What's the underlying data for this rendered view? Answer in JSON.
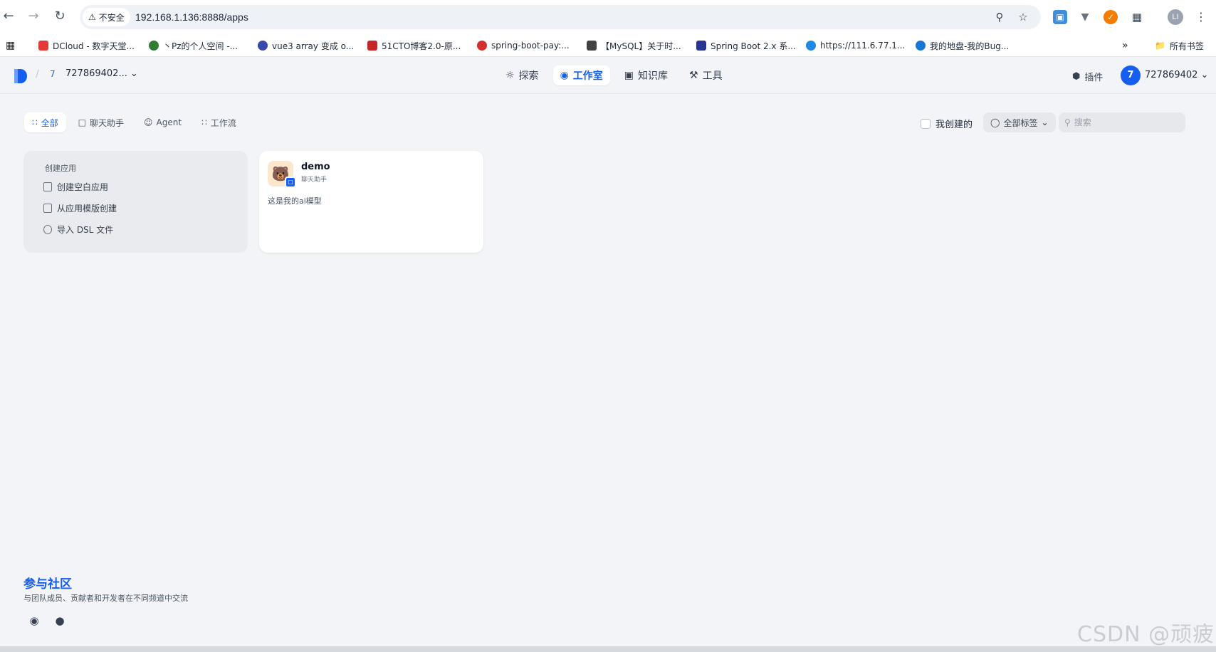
{
  "browser": {
    "security_label": "不安全",
    "url": "192.168.1.136:8888/apps",
    "profile_initials": "LI",
    "all_bookmarks": "所有书签",
    "bookmarks": [
      {
        "label": "DCloud - 数字天堂...",
        "color": "#e53935"
      },
      {
        "label": "丶Pz的个人空间 -...",
        "color": "#2e7d32"
      },
      {
        "label": "vue3 array 变成 o...",
        "color": "#3949ab"
      },
      {
        "label": "51CTO博客2.0-原...",
        "color": "#c62828"
      },
      {
        "label": "spring-boot-pay:...",
        "color": "#d32f2f"
      },
      {
        "label": "【MySQL】关于时...",
        "color": "#424242"
      },
      {
        "label": "Spring Boot 2.x 系...",
        "color": "#283593"
      },
      {
        "label": "https://111.6.77.1...",
        "color": "#1e88e5"
      },
      {
        "label": "我的地盘-我的Bug...",
        "color": "#1976d2"
      }
    ]
  },
  "header": {
    "workspace_number": "7",
    "workspace_name": "727869402...",
    "nav": {
      "explore": "探索",
      "studio": "工作室",
      "knowledge": "知识库",
      "tools": "工具"
    },
    "plugins": "插件",
    "avatar_initial": "7",
    "user_name": "727869402"
  },
  "filters": {
    "tabs": {
      "all": "全部",
      "chat": "聊天助手",
      "agent": "Agent",
      "workflow": "工作流"
    },
    "created_by_me": "我创建的",
    "all_tags": "全部标签",
    "search_placeholder": "搜索"
  },
  "create_card": {
    "title": "创建应用",
    "blank": "创建空白应用",
    "template": "从应用模版创建",
    "import_dsl": "导入 DSL 文件"
  },
  "apps": [
    {
      "name": "demo",
      "type": "聊天助手",
      "description": "这是我的ai模型"
    }
  ],
  "footer": {
    "title": "参与社区",
    "subtitle": "与团队成员、贡献者和开发者在不同频道中交流"
  },
  "watermark": "CSDN @顽疲",
  "colors": {
    "accent": "#155eef",
    "background": "#f2f4f7"
  }
}
